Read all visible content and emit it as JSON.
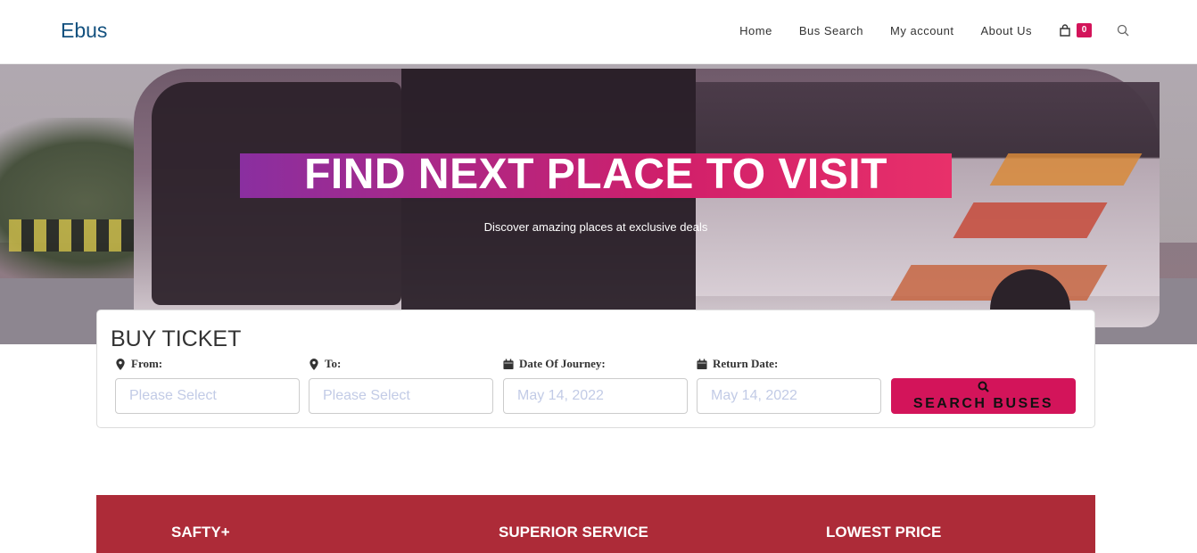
{
  "brand": {
    "name": "Ebus",
    "color": "#13517f"
  },
  "nav": {
    "items": [
      {
        "label": "Home"
      },
      {
        "label": "Bus Search"
      },
      {
        "label": "My account"
      },
      {
        "label": "About Us"
      }
    ],
    "cart_count": "0"
  },
  "hero": {
    "title": "FIND NEXT PLACE TO VISIT",
    "subtitle": "Discover amazing places at exclusive deals"
  },
  "ticket": {
    "heading": "BUY TICKET",
    "from_label": "From:",
    "from_placeholder": "Please Select",
    "to_label": "To:",
    "to_placeholder": "Please Select",
    "journey_label": "Date Of Journey:",
    "journey_value": "May 14, 2022",
    "return_label": "Return Date:",
    "return_value": "May 14, 2022",
    "search_label": "SEARCH BUSES"
  },
  "features": [
    {
      "label": "SAFTY+"
    },
    {
      "label": "SUPERIOR SERVICE"
    },
    {
      "label": "LOWEST PRICE"
    }
  ],
  "colors": {
    "accent": "#d3145a",
    "band": "#ad2b38"
  }
}
